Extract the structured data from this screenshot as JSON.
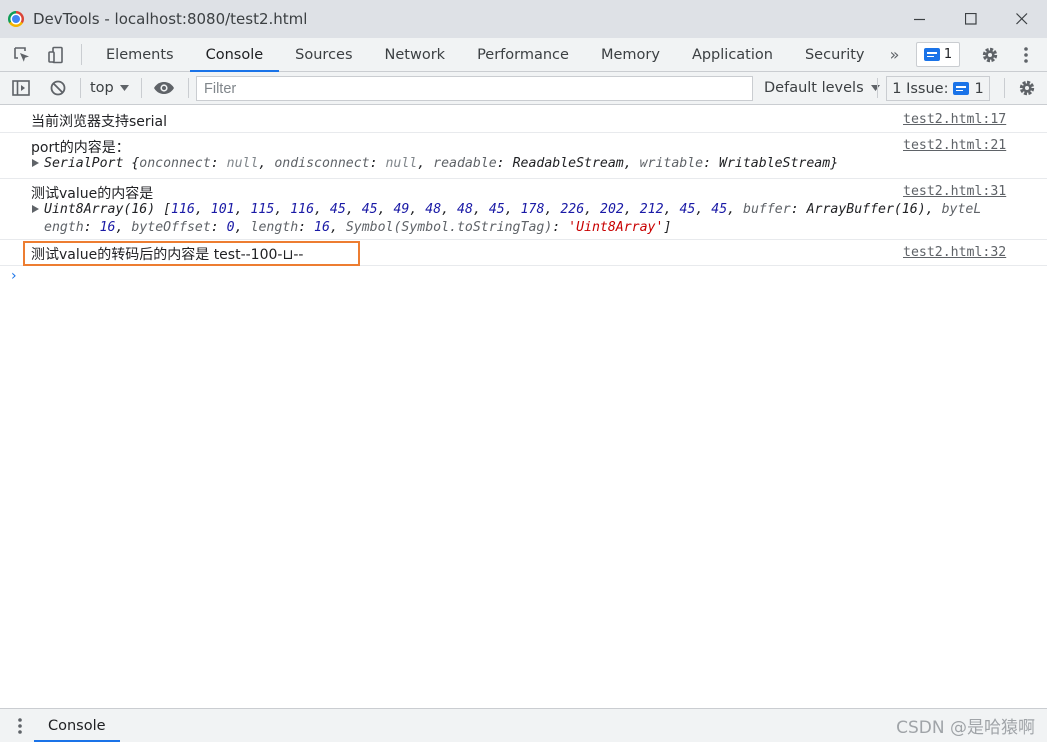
{
  "window": {
    "title": "DevTools - localhost:8080/test2.html",
    "controls": [
      "minimize-icon",
      "maximize-icon",
      "close-icon"
    ]
  },
  "tabs": [
    {
      "label": "Elements"
    },
    {
      "label": "Console",
      "active": true
    },
    {
      "label": "Sources"
    },
    {
      "label": "Network"
    },
    {
      "label": "Performance"
    },
    {
      "label": "Memory"
    },
    {
      "label": "Application"
    },
    {
      "label": "Security"
    }
  ],
  "tab_more": "»",
  "issues_badge": {
    "count": "1"
  },
  "toolbar": {
    "context": "top",
    "filter_placeholder": "Filter",
    "levels": "Default levels",
    "issue_label": "1 Issue:",
    "issue_count": "1"
  },
  "messages": {
    "m1": {
      "text": "当前浏览器支持serial",
      "source": "test2.html:17"
    },
    "m2": {
      "text": "port的内容是：",
      "source": "test2.html:21",
      "object": {
        "class": "SerialPort",
        "props": [
          {
            "key": "onconnect",
            "value": "null"
          },
          {
            "key": "ondisconnect",
            "value": "null"
          },
          {
            "key": "readable",
            "value": "ReadableStream"
          },
          {
            "key": "writable",
            "value": "WritableStream"
          }
        ]
      }
    },
    "m3": {
      "text": "测试value的内容是",
      "source": "test2.html:31",
      "object": {
        "class": "Uint8Array(16)",
        "items": [
          "116",
          "101",
          "115",
          "116",
          "45",
          "45",
          "49",
          "48",
          "48",
          "45",
          "178",
          "226",
          "202",
          "212",
          "45",
          "45"
        ],
        "buffer_key": "buffer",
        "buffer_value": "ArrayBuffer(16)",
        "line1_tail": "byteL",
        "line2_head": "ength",
        "byteLength": "16",
        "byteOffset_key": "byteOffset",
        "byteOffset": "0",
        "length_key": "length",
        "length": "16",
        "symbol_key": "Symbol(Symbol.toStringTag)",
        "symbol_value": "'Uint8Array'"
      }
    },
    "m4": {
      "text": "测试value的转码后的内容是 test--100-⊔--",
      "source": "test2.html:32"
    }
  },
  "prompt_symbol": "›",
  "drawer": {
    "tab": "Console"
  },
  "watermark": "CSDN @是哈猿啊",
  "colors": {
    "accent": "#1a73e8",
    "highlight_box": "#ed7d31",
    "number": "#1a1aa6",
    "string": "#c80000"
  }
}
